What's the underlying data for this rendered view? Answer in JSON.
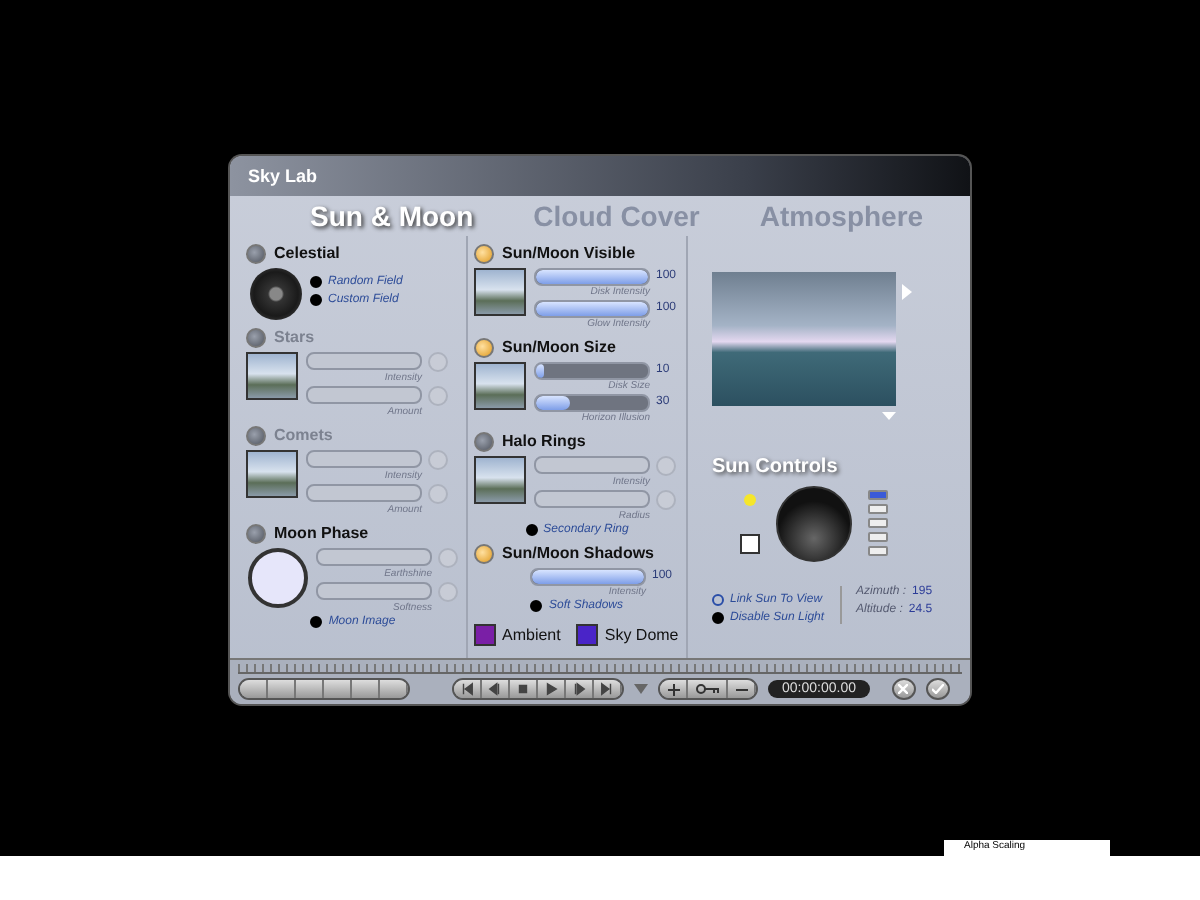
{
  "window": {
    "title": "Sky Lab"
  },
  "tabs": [
    {
      "label": "Sun & Moon",
      "selected": true
    },
    {
      "label": "Cloud Cover",
      "selected": false
    },
    {
      "label": "Atmosphere",
      "selected": false
    }
  ],
  "columns": [
    {
      "sections": [
        {
          "title": "Celestial",
          "on": false,
          "disabled": false,
          "kind": "dial",
          "options": [
            {
              "label": "Random Field",
              "checked": true
            },
            {
              "label": "Custom Field",
              "checked": true
            }
          ]
        },
        {
          "title": "Stars",
          "on": false,
          "disabled": true,
          "kind": "photo",
          "sliders": [
            {
              "label": "Intensity"
            },
            {
              "label": "Amount"
            }
          ]
        },
        {
          "title": "Comets",
          "on": false,
          "disabled": true,
          "kind": "photo",
          "sliders": [
            {
              "label": "Intensity"
            },
            {
              "label": "Amount"
            }
          ]
        },
        {
          "title": "Moon Phase",
          "on": false,
          "disabled": false,
          "kind": "moon",
          "sliders": [
            {
              "label": "Earthshine"
            },
            {
              "label": "Softness"
            }
          ],
          "options": [
            {
              "label": "Moon Image",
              "checked": true
            }
          ]
        }
      ]
    },
    {
      "sections": [
        {
          "title": "Sun/Moon Visible",
          "on": true,
          "disabled": false,
          "kind": "photo",
          "sliders": [
            {
              "label": "Disk Intensity",
              "level": 1,
              "reading": "100"
            },
            {
              "label": "Glow Intensity",
              "level": 1,
              "reading": "100"
            }
          ]
        },
        {
          "title": "Sun/Moon Size",
          "on": true,
          "disabled": false,
          "kind": "photo",
          "sliders": [
            {
              "label": "Disk Size",
              "level": 0.08,
              "reading": "10"
            },
            {
              "label": "Horizon Illusion",
              "level": 0.3,
              "reading": "30"
            }
          ]
        },
        {
          "title": "Halo Rings",
          "on": false,
          "disabled": false,
          "kind": "photo",
          "sliders": [
            {
              "label": "Intensity"
            },
            {
              "label": "Radius"
            }
          ],
          "options": [
            {
              "label": "Secondary Ring",
              "checked": true
            }
          ]
        },
        {
          "title": "Sun/Moon Shadows",
          "on": true,
          "disabled": false,
          "kind": "plain",
          "sliders": [
            {
              "label": "Intensity",
              "level": 1,
              "reading": "100"
            }
          ],
          "options": [
            {
              "label": "Soft Shadows",
              "checked": true
            }
          ]
        }
      ],
      "swatches": [
        {
          "label": "Ambient",
          "color": "#7a1fa6"
        },
        {
          "label": "Sky Dome",
          "color": "#4a24c8"
        }
      ]
    }
  ],
  "sun_controls": {
    "title": "Sun Controls",
    "options": [
      {
        "label": "Link Sun To View",
        "checked": false
      },
      {
        "label": "Disable Sun Light",
        "checked": true
      }
    ],
    "readouts": [
      {
        "label": "Azimuth :",
        "value": "195"
      },
      {
        "label": "Altitude :",
        "value": "24.5"
      }
    ]
  },
  "transport": {
    "time": "00:00:00.00"
  },
  "tooltip": "Alpha Scaling"
}
